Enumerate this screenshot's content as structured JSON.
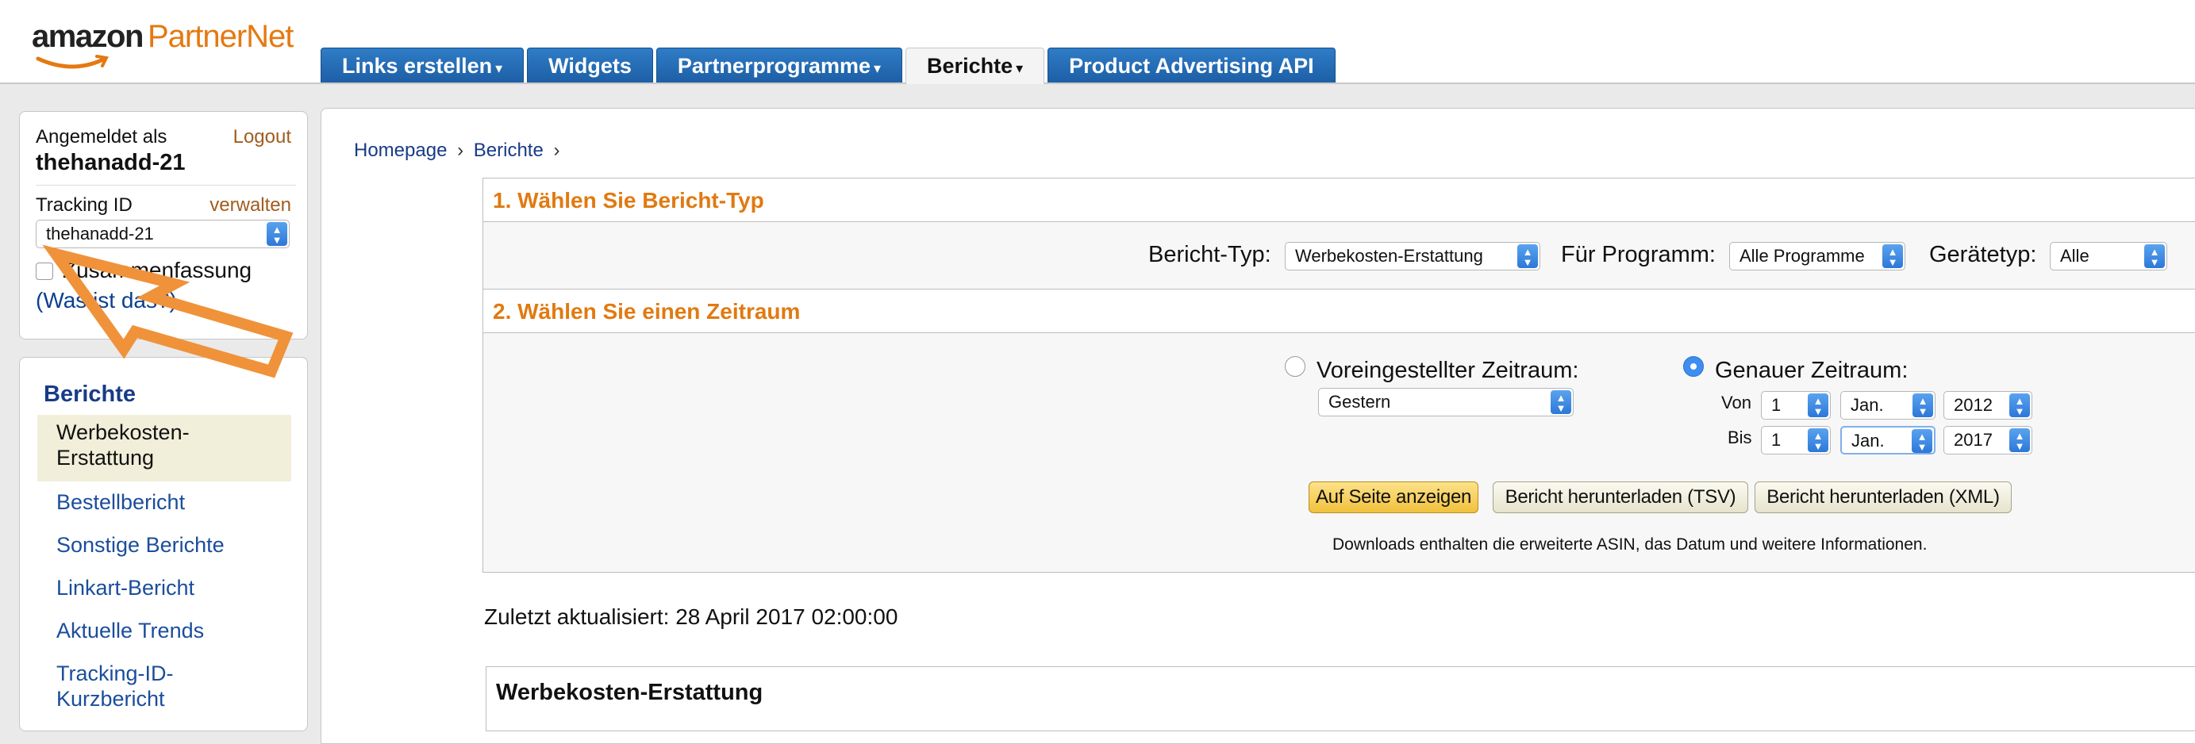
{
  "header": {
    "logo_part1": "amazon",
    "logo_part2": "PartnerNet",
    "tabs": [
      {
        "label": "Links erstellen",
        "caret": "▾"
      },
      {
        "label": "Widgets"
      },
      {
        "label": "Partnerprogramme",
        "caret": "▾"
      },
      {
        "label": "Berichte",
        "caret": "▾",
        "active": true
      },
      {
        "label": "Product Advertising API"
      }
    ]
  },
  "account": {
    "logged_in_label": "Angemeldet als",
    "logout_label": "Logout",
    "username": "thehanadd-21",
    "tracking_id_label": "Tracking ID",
    "manage_label": "verwalten",
    "tracking_id_value": "thehanadd-21",
    "summary_label": "Zusammenfassung",
    "summary_checked": false,
    "what_is_label": "(Was ist das?)"
  },
  "reports_nav": {
    "title": "Berichte",
    "items": [
      {
        "label": "Werbekosten-Erstattung",
        "active": true
      },
      {
        "label": "Bestellbericht"
      },
      {
        "label": "Sonstige Berichte"
      },
      {
        "label": "Linkart-Bericht"
      },
      {
        "label": "Aktuelle Trends"
      },
      {
        "label": "Tracking-ID-Kurzbericht"
      }
    ]
  },
  "breadcrumb": {
    "items": [
      "Homepage",
      "Berichte"
    ],
    "separator": "›"
  },
  "step1": {
    "title": "1. Wählen Sie Bericht-Typ",
    "report_type_label": "Bericht-Typ:",
    "report_type_value": "Werbekosten-Erstattung",
    "program_label": "Für Programm:",
    "program_value": "Alle Programme",
    "device_label": "Gerätetyp:",
    "device_value": "Alle"
  },
  "step2": {
    "title": "2. Wählen Sie einen Zeitraum",
    "preset_label": "Voreingestellter Zeitraum:",
    "preset_selected": false,
    "preset_value": "Gestern",
    "exact_label": "Genauer Zeitraum:",
    "exact_selected": true,
    "from_label": "Von",
    "from_day": "1",
    "from_month": "Jan.",
    "from_year": "2012",
    "to_label": "Bis",
    "to_day": "1",
    "to_month": "Jan.",
    "to_year": "2017",
    "btn_show": "Auf Seite anzeigen",
    "btn_tsv": "Bericht herunterladen (TSV)",
    "btn_xml": "Bericht herunterladen (XML)",
    "download_info": "Downloads enthalten die erweiterte ASIN, das Datum und weitere Informationen."
  },
  "last_updated": "Zuletzt aktualisiert: 28 April 2017 02:00:00",
  "result_title": "Werbekosten-Erstattung",
  "colors": {
    "tab_blue": "#1d5fa6",
    "section_orange": "#e07a11",
    "link_blue": "#1b4d9c",
    "annotation_arrow": "#f0923a"
  }
}
